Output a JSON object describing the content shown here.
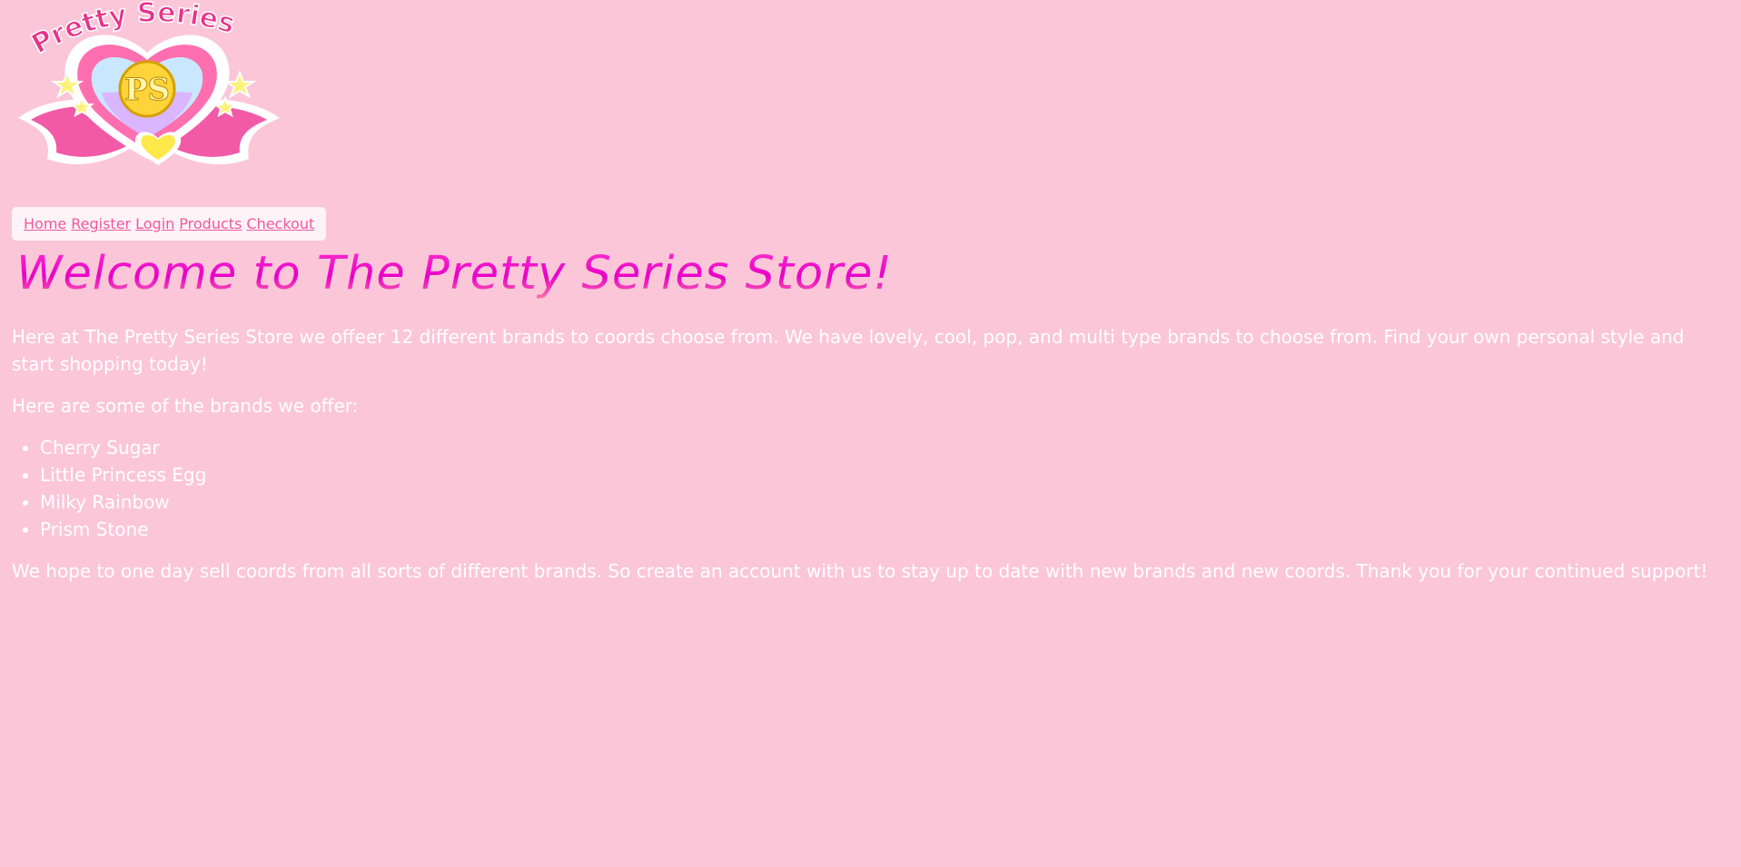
{
  "logo": {
    "text": "Pretty Series",
    "monogram": "PS",
    "colors": {
      "heart": "#ff6fb0",
      "ribbon": "#f25aa8",
      "gold": "#ffd43b",
      "outline": "#ffffff"
    }
  },
  "nav": {
    "items": [
      {
        "label": "Home"
      },
      {
        "label": "Register"
      },
      {
        "label": "Login"
      },
      {
        "label": "Products"
      },
      {
        "label": "Checkout"
      }
    ]
  },
  "page": {
    "title": "Welcome to The Pretty Series Store!",
    "intro": "Here at The Pretty Series Store we offeer 12 different brands to coords choose from. We have lovely, cool, pop, and multi type brands to choose from. Find your own personal style and start shopping today!",
    "brands_heading": "Here are some of the brands we offer:",
    "brands": [
      "Cherry Sugar",
      "Little Princess Egg",
      "Milky Rainbow",
      "Prism Stone"
    ],
    "closing": "We hope to one day sell coords from all sorts of different brands. So create an account with us to stay up to date with new brands and new coords. Thank you for your continued support!"
  },
  "theme": {
    "background": "#fcc6d9",
    "nav_background": "#fef3f7",
    "link_color": "#f0589f",
    "title_color": "#e800c7",
    "text_color": "#ffffff"
  }
}
